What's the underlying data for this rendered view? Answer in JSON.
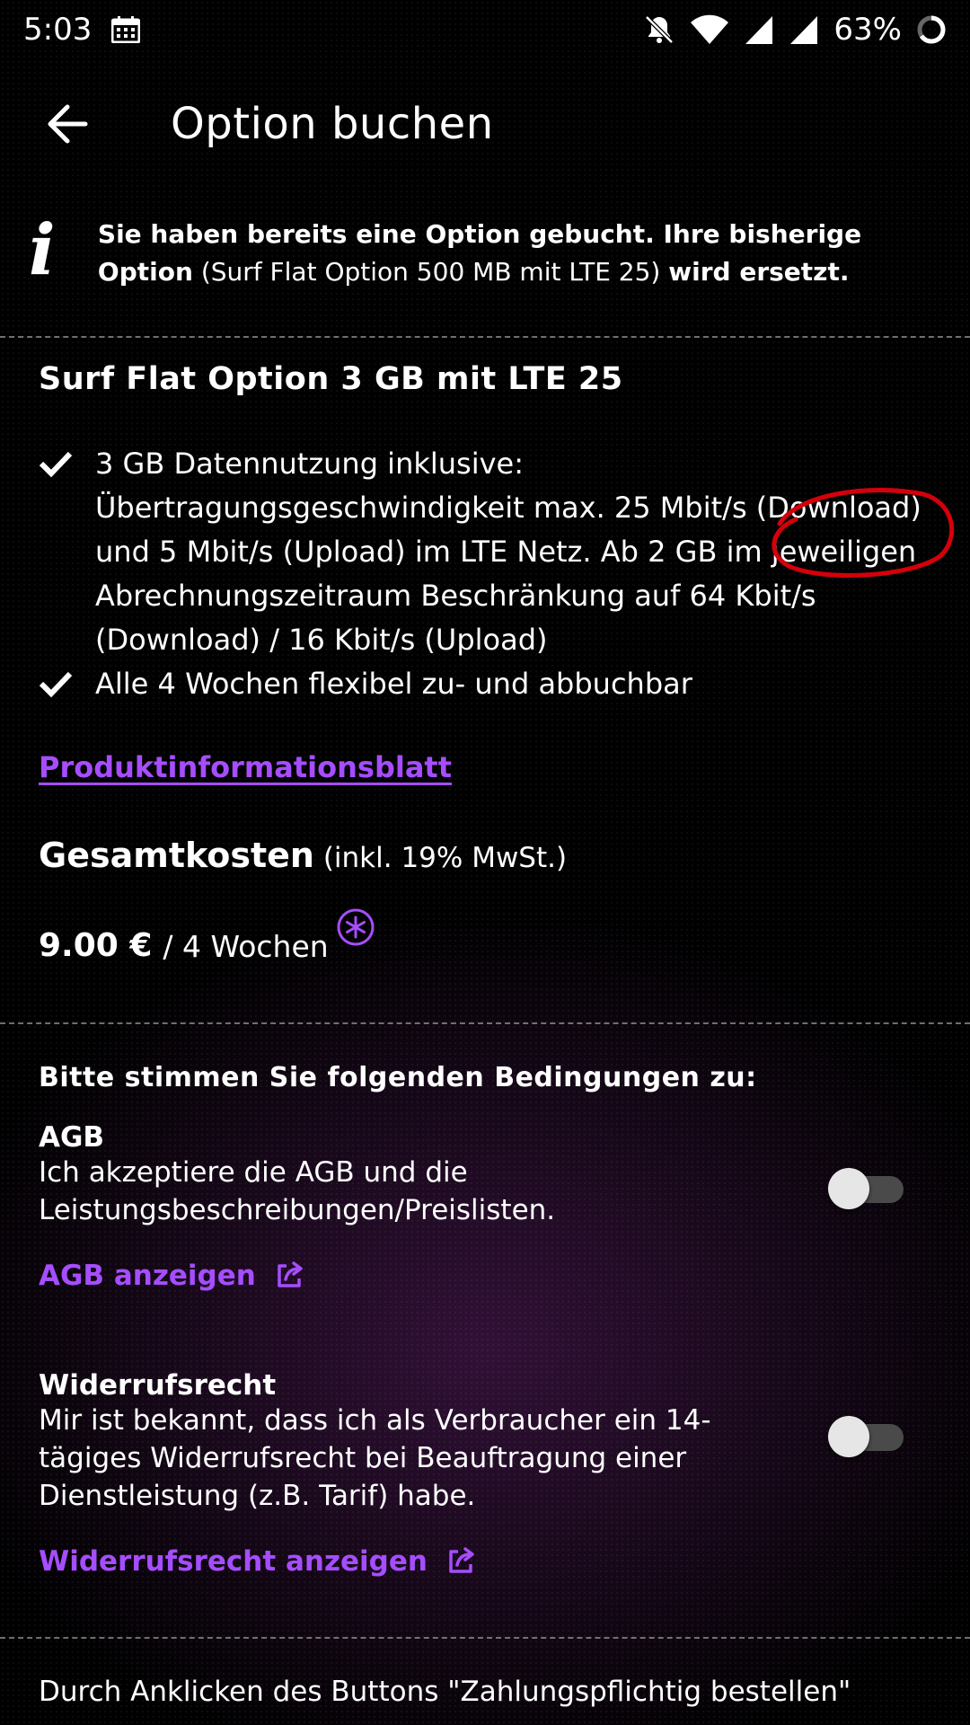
{
  "status_bar": {
    "time": "5:03",
    "battery": "63%"
  },
  "app_bar": {
    "title": "Option buchen"
  },
  "info_banner": {
    "icon": "info-icon",
    "text_bold_1": "Sie haben bereits eine Option gebucht. Ihre bisherige Option",
    "text_normal": "(Surf Flat Option 500 MB mit LTE 25)",
    "text_bold_2": "wird ersetzt."
  },
  "offer": {
    "title": "Surf Flat Option 3 GB mit LTE 25",
    "features": [
      "3 GB Datennutzung inklusive: Übertragungsgeschwindigkeit max. 25 Mbit/s (Download) und 5 Mbit/s (Upload) im LTE Netz. Ab 2 GB im jeweiligen Abrechnungszeitraum Beschränkung auf 64 Kbit/s (Download) / 16 Kbit/s (Upload)",
      "Alle 4 Wochen flexibel zu- und abbuchbar"
    ],
    "info_link": "Produktinformationsblatt"
  },
  "costs": {
    "label": "Gesamtkosten",
    "note": "(inkl. 19% MwSt.)",
    "amount": "9.00 €",
    "period": "/ 4 Wochen"
  },
  "terms": {
    "heading": "Bitte stimmen Sie folgenden Bedingungen zu:",
    "agb": {
      "title": "AGB",
      "text": "Ich akzeptiere die AGB und die Leistungsbeschreibungen/Preislisten.",
      "link": "AGB anzeigen",
      "accepted": false
    },
    "widerruf": {
      "title": "Widerrufsrecht",
      "text": "Mir ist bekannt, dass ich als Verbraucher ein 14-tägiges Widerrufsrecht bei Beauftragung einer Dienstleistung (z.B. Tarif) habe.",
      "link": "Widerrufsrecht anzeigen",
      "accepted": false
    }
  },
  "footer": {
    "text": "Durch Anklicken des Buttons \"Zahlungspflichtig bestellen\""
  },
  "colors": {
    "accent": "#a64dff",
    "annotation": "#d4000b"
  }
}
